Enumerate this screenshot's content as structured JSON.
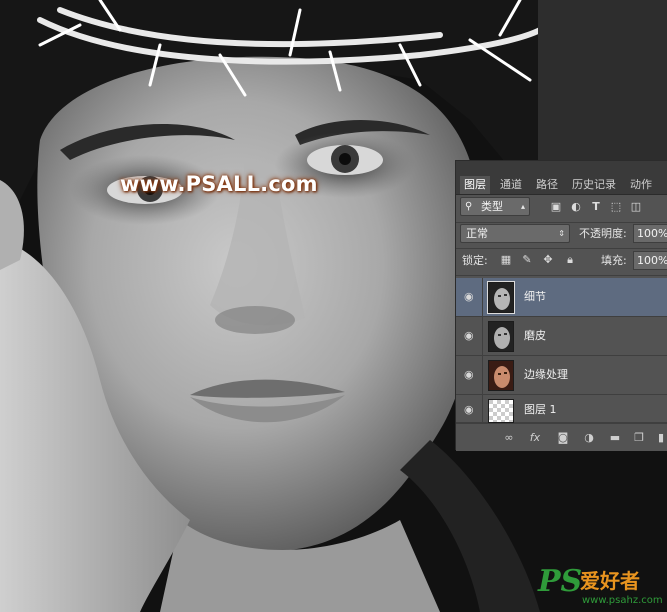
{
  "watermark_top": "www.PSALL.com",
  "logo": {
    "ps": "PS",
    "cn": "爱好者",
    "url": "www.psahz.com"
  },
  "panel": {
    "tabs": [
      "图层",
      "通道",
      "路径",
      "历史记录",
      "动作"
    ],
    "filter": {
      "kind_label": "类型",
      "search_icon": "search-icon"
    },
    "filter_icons": [
      "image-filter-icon",
      "adjustment-filter-icon",
      "type-filter-icon",
      "shape-filter-icon",
      "smart-object-filter-icon"
    ],
    "blend_mode": "正常",
    "opacity_label": "不透明度:",
    "opacity_value": "100%",
    "lock_label": "锁定:",
    "lock_icons": [
      "lock-transparent-icon",
      "lock-brush-icon",
      "lock-move-icon",
      "lock-all-icon"
    ],
    "fill_label": "填充:",
    "fill_value": "100%",
    "layers": [
      {
        "name": "细节",
        "selected": true,
        "thumb": "bw-face"
      },
      {
        "name": "磨皮",
        "selected": false,
        "thumb": "bw-face"
      },
      {
        "name": "边缘处理",
        "selected": false,
        "thumb": "color-face"
      },
      {
        "name": "图层 1",
        "selected": false,
        "thumb": "transparent"
      }
    ],
    "bottom_icons": [
      "link-layers-icon",
      "fx-icon",
      "add-mask-icon",
      "adjustment-layer-icon",
      "new-group-icon",
      "new-layer-icon",
      "delete-layer-icon"
    ]
  },
  "colors": {
    "panel_bg": "#535353",
    "selection": "#5e6b80",
    "watermark_glow": "#8a3b12",
    "logo_green": "#2f9b3a",
    "logo_orange": "#e8941f"
  }
}
